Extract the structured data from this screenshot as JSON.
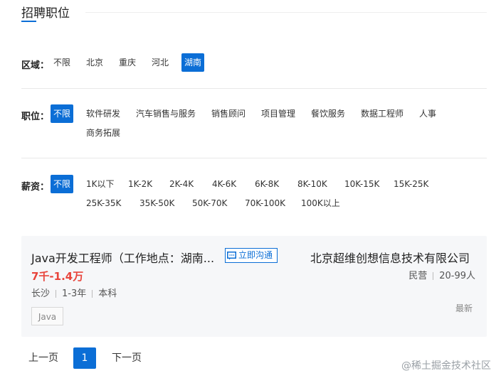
{
  "section": {
    "title": "招聘职位"
  },
  "filters": {
    "region": {
      "label": "区域：",
      "options": [
        "不限",
        "北京",
        "重庆",
        "河北",
        "湖南"
      ],
      "selected": "湖南"
    },
    "position": {
      "label": "职位：",
      "options": [
        "不限",
        "软件研发",
        "汽车销售与服务",
        "销售顾问",
        "项目管理",
        "餐饮服务",
        "数据工程师",
        "人事",
        "商务拓展"
      ],
      "selected": "不限"
    },
    "salary": {
      "label": "薪资：",
      "options": [
        "不限",
        "1K以下",
        "1K-2K",
        "2K-4K",
        "4K-6K",
        "6K-8K",
        "8K-10K",
        "10K-15K",
        "15K-25K",
        "25K-35K",
        "35K-50K",
        "50K-70K",
        "70K-100K",
        "100K以上"
      ],
      "selected": "不限"
    }
  },
  "job": {
    "title": "Java开发工程师（工作地点：湖南...",
    "chat_label": "立即沟通",
    "salary": "7千-1.4万",
    "city": "长沙",
    "experience": "1-3年",
    "education": "本科",
    "tag": "Java",
    "company": "北京超维创想信息技术有限公司",
    "company_type": "民营",
    "company_size": "20-99人",
    "freshness": "最新"
  },
  "pagination": {
    "prev": "上一页",
    "current": "1",
    "next": "下一页"
  },
  "watermark": "@稀土掘金技术社区",
  "colors": {
    "accent": "#0b6ed6",
    "salary": "#e8453c"
  },
  "icons": {
    "chat": "chat-bubble-icon"
  }
}
